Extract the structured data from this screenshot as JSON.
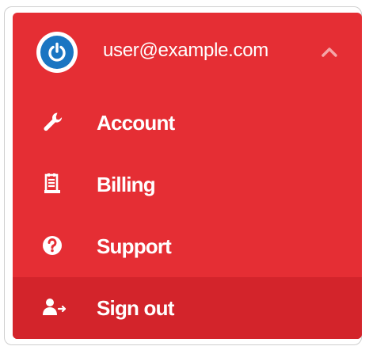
{
  "colors": {
    "menu_bg": "#e52e34",
    "active_item_bg": "#d3242b",
    "avatar_blue": "#1a75c2",
    "text": "#ffffff"
  },
  "header": {
    "email": "user@example.com",
    "avatar_icon": "power-icon",
    "toggle_icon": "chevron-up-icon"
  },
  "items": [
    {
      "label": "Account",
      "icon": "wrench-icon"
    },
    {
      "label": "Billing",
      "icon": "receipt-icon"
    },
    {
      "label": "Support",
      "icon": "question-circle-icon"
    },
    {
      "label": "Sign out",
      "icon": "user-sign-out-icon",
      "active": true
    }
  ]
}
